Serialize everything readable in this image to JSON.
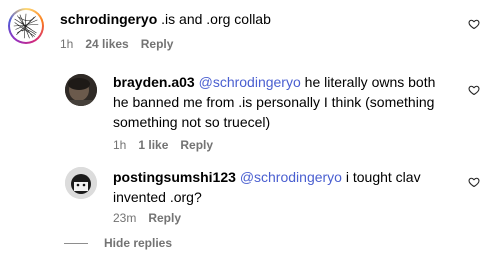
{
  "comments": [
    {
      "username": "schrodingeryo",
      "text": " .is and .org collab",
      "time": "1h",
      "likes": "24 likes",
      "reply_label": "Reply"
    }
  ],
  "replies": [
    {
      "username": "brayden.a03",
      "mention": "@schrodingeryo",
      "text_line1": " he literally owns both",
      "text_line2": "he banned me from .is personally I think (something",
      "text_line3": "something not so truecel)",
      "time": "1h",
      "likes": "1 like",
      "reply_label": "Reply"
    },
    {
      "username": "postingsumshi123",
      "mention": "@schrodingeryo",
      "text_line1": " i tought clav",
      "text_line2": "invented .org?",
      "time": "23m",
      "reply_label": "Reply"
    }
  ],
  "hide_replies_label": "Hide replies",
  "icons": {
    "like": "heart-icon"
  },
  "colors": {
    "mention": "#4a5fd0",
    "meta": "#737373"
  }
}
